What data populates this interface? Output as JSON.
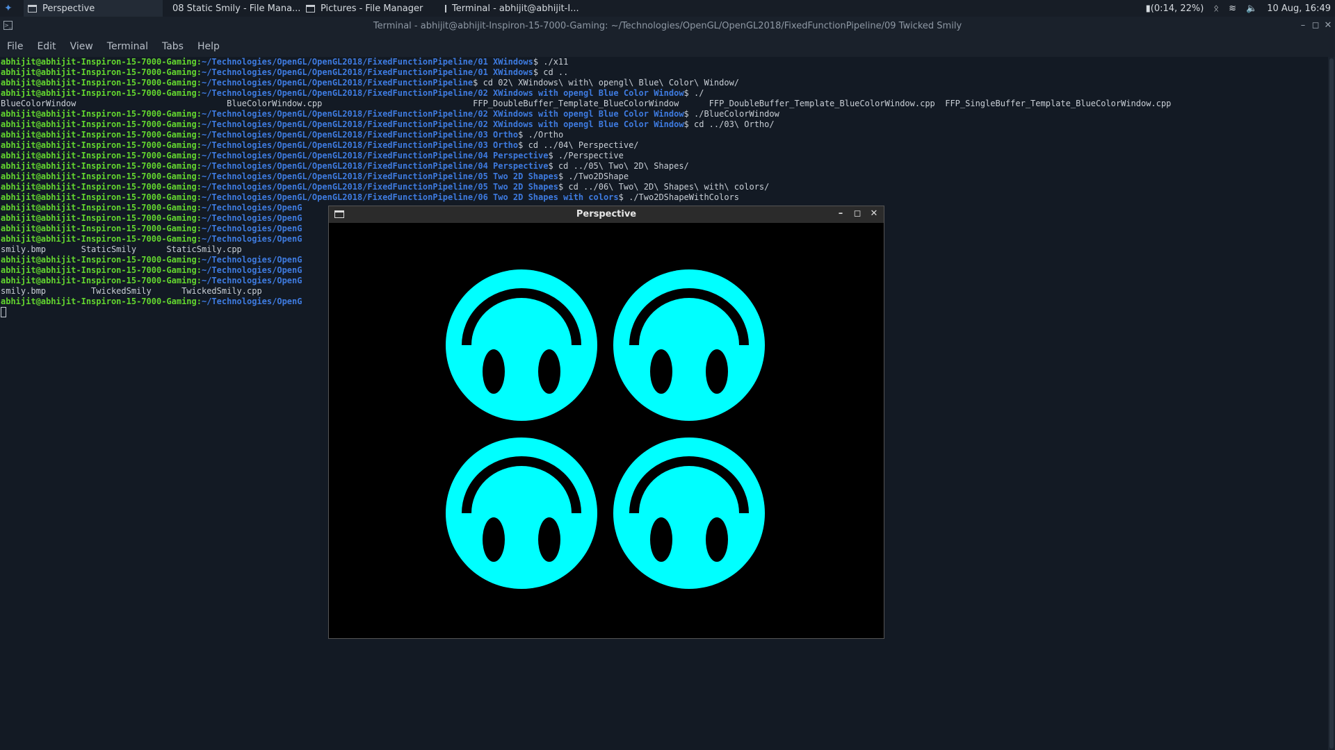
{
  "taskbar": {
    "tasks": [
      {
        "label": "Perspective",
        "icon": "window-icon"
      },
      {
        "label": "08 Static Smily - File Mana...",
        "icon": "folder-icon"
      },
      {
        "label": "Pictures - File Manager",
        "icon": "file-manager-icon"
      },
      {
        "label": "Terminal - abhijit@abhijit-I...",
        "icon": "terminal-icon"
      }
    ],
    "battery": "(0:14, 22%)",
    "datetime": "10 Aug, 16:49",
    "tray_icons": [
      "battery-icon",
      "bluetooth-icon",
      "wifi-icon",
      "volume-icon"
    ]
  },
  "terminal": {
    "title": "Terminal - abhijit@abhijit-Inspiron-15-7000-Gaming: ~/Technologies/OpenGL/OpenGL2018/FixedFunctionPipeline/09 Twicked Smily",
    "menu": [
      "File",
      "Edit",
      "View",
      "Terminal",
      "Tabs",
      "Help"
    ],
    "lines": [
      {
        "u": "abhijit@abhijit-Inspiron-15-7000-Gaming:",
        "p": "~/Technologies/OpenGL/OpenGL2018/FixedFunctionPipeline/01 XWindows",
        "c": "$ ./x11"
      },
      {
        "u": "abhijit@abhijit-Inspiron-15-7000-Gaming:",
        "p": "~/Technologies/OpenGL/OpenGL2018/FixedFunctionPipeline/01 XWindows",
        "c": "$ cd .."
      },
      {
        "u": "abhijit@abhijit-Inspiron-15-7000-Gaming:",
        "p": "~/Technologies/OpenGL/OpenGL2018/FixedFunctionPipeline",
        "c": "$ cd 02\\ XWindows\\ with\\ opengl\\ Blue\\ Color\\ Window/"
      },
      {
        "u": "abhijit@abhijit-Inspiron-15-7000-Gaming:",
        "p": "~/Technologies/OpenGL/OpenGL2018/FixedFunctionPipeline/02 XWindows with opengl Blue Color Window",
        "c": "$ ./"
      },
      {
        "u": "",
        "p": "",
        "c": "BlueColorWindow                              BlueColorWindow.cpp                              FFP_DoubleBuffer_Template_BlueColorWindow      FFP_DoubleBuffer_Template_BlueColorWindow.cpp  FFP_SingleBuffer_Template_BlueColorWindow.cpp"
      },
      {
        "u": "abhijit@abhijit-Inspiron-15-7000-Gaming:",
        "p": "~/Technologies/OpenGL/OpenGL2018/FixedFunctionPipeline/02 XWindows with opengl Blue Color Window",
        "c": "$ ./BlueColorWindow"
      },
      {
        "u": "abhijit@abhijit-Inspiron-15-7000-Gaming:",
        "p": "~/Technologies/OpenGL/OpenGL2018/FixedFunctionPipeline/02 XWindows with opengl Blue Color Window",
        "c": "$ cd ../03\\ Ortho/"
      },
      {
        "u": "abhijit@abhijit-Inspiron-15-7000-Gaming:",
        "p": "~/Technologies/OpenGL/OpenGL2018/FixedFunctionPipeline/03 Ortho",
        "c": "$ ./Ortho"
      },
      {
        "u": "abhijit@abhijit-Inspiron-15-7000-Gaming:",
        "p": "~/Technologies/OpenGL/OpenGL2018/FixedFunctionPipeline/03 Ortho",
        "c": "$ cd ../04\\ Perspective/"
      },
      {
        "u": "abhijit@abhijit-Inspiron-15-7000-Gaming:",
        "p": "~/Technologies/OpenGL/OpenGL2018/FixedFunctionPipeline/04 Perspective",
        "c": "$ ./Perspective"
      },
      {
        "u": "abhijit@abhijit-Inspiron-15-7000-Gaming:",
        "p": "~/Technologies/OpenGL/OpenGL2018/FixedFunctionPipeline/04 Perspective",
        "c": "$ cd ../05\\ Two\\ 2D\\ Shapes/"
      },
      {
        "u": "abhijit@abhijit-Inspiron-15-7000-Gaming:",
        "p": "~/Technologies/OpenGL/OpenGL2018/FixedFunctionPipeline/05 Two 2D Shapes",
        "c": "$ ./Two2DShape"
      },
      {
        "u": "abhijit@abhijit-Inspiron-15-7000-Gaming:",
        "p": "~/Technologies/OpenGL/OpenGL2018/FixedFunctionPipeline/05 Two 2D Shapes",
        "c": "$ cd ../06\\ Two\\ 2D\\ Shapes\\ with\\ colors/"
      },
      {
        "u": "abhijit@abhijit-Inspiron-15-7000-Gaming:",
        "p": "~/Technologies/OpenGL/OpenGL2018/FixedFunctionPipeline/06 Two 2D Shapes with colors",
        "c": "$ ./Two2DShapeWithColors"
      },
      {
        "u": "abhijit@abhijit-Inspiron-15-7000-Gaming:",
        "p": "~/Technologies/OpenG",
        "c": ""
      },
      {
        "u": "abhijit@abhijit-Inspiron-15-7000-Gaming:",
        "p": "~/Technologies/OpenG",
        "c": ""
      },
      {
        "u": "abhijit@abhijit-Inspiron-15-7000-Gaming:",
        "p": "~/Technologies/OpenG",
        "c": ""
      },
      {
        "u": "abhijit@abhijit-Inspiron-15-7000-Gaming:",
        "p": "~/Technologies/OpenG",
        "c": ""
      },
      {
        "u": "",
        "p": "",
        "c": "smily.bmp       StaticSmily      StaticSmily.cpp"
      },
      {
        "u": "abhijit@abhijit-Inspiron-15-7000-Gaming:",
        "p": "~/Technologies/OpenG",
        "c": ""
      },
      {
        "u": "abhijit@abhijit-Inspiron-15-7000-Gaming:",
        "p": "~/Technologies/OpenG",
        "c": ""
      },
      {
        "u": "abhijit@abhijit-Inspiron-15-7000-Gaming:",
        "p": "~/Technologies/OpenG",
        "c": ""
      },
      {
        "u": "",
        "p": "",
        "c": "smily.bmp         TwickedSmily      TwickedSmily.cpp"
      },
      {
        "u": "abhijit@abhijit-Inspiron-15-7000-Gaming:",
        "p": "~/Technologies/OpenG",
        "c": ""
      }
    ]
  },
  "perspective_window": {
    "title": "Perspective",
    "smiley_color": "#00ffff",
    "smiley_count": 4
  }
}
